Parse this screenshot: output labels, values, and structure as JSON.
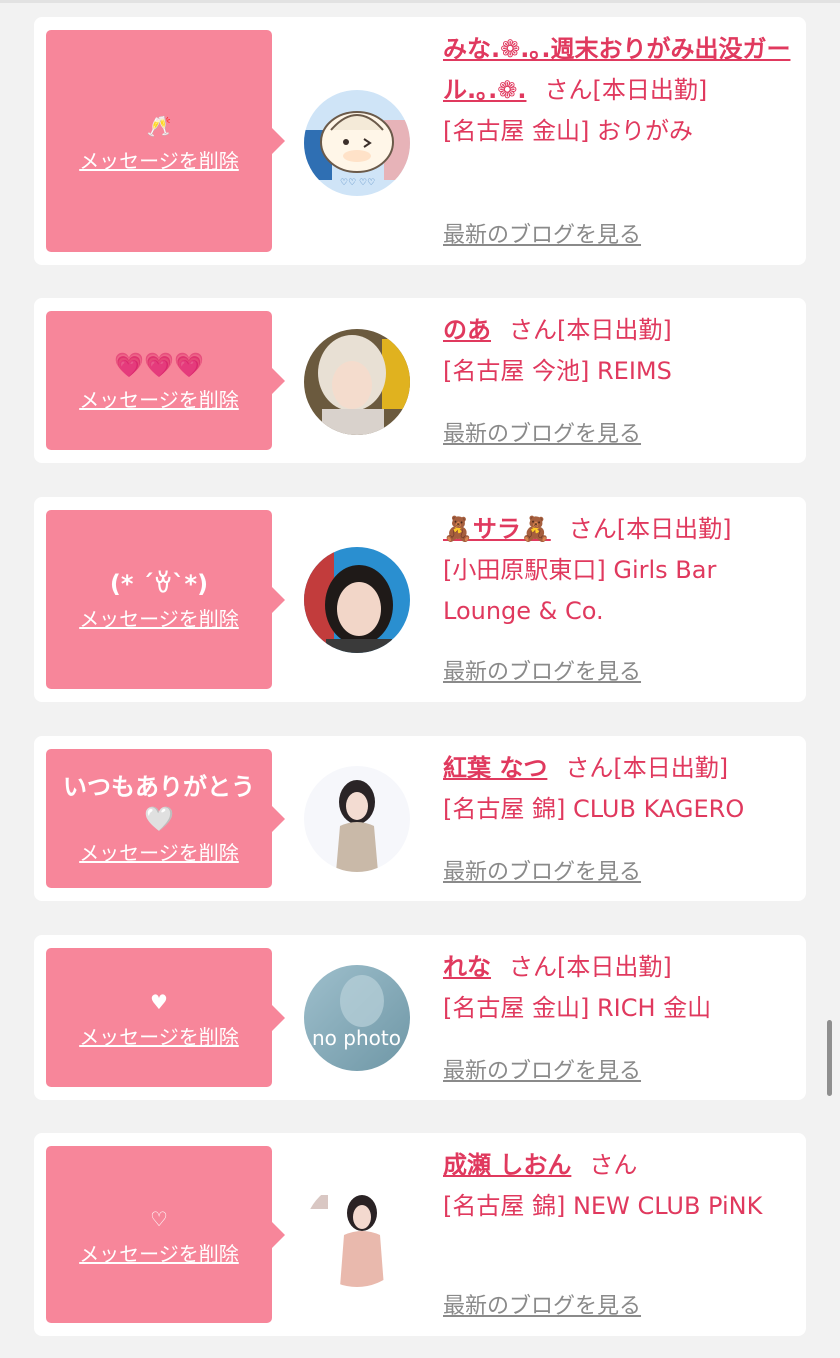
{
  "delete_label": "メッセージを削除",
  "blog_label": "最新のブログを見る",
  "suffix_san": "さん",
  "colors": {
    "bubble": "#f7869a",
    "accent": "#e0395e",
    "link_gray": "#8a8a8a",
    "background": "#f2f2f2"
  },
  "cards": [
    {
      "message": "🥂",
      "name": "みな.❁.｡.週末おりがみ出没ガール.｡.❁.",
      "status": "[本日出勤]",
      "shop": "[名古屋 金山] おりがみ",
      "avatar": "cartoon-character-avatar"
    },
    {
      "message": "💗💗💗",
      "name": "のあ",
      "status": "[本日出勤]",
      "shop": "[名古屋 今池] REIMS",
      "avatar": "profile-photo"
    },
    {
      "message": "(* ´ꈊ`*)",
      "name": "🧸サラ🧸",
      "status": "[本日出勤]",
      "shop": "[小田原駅東口] Girls Bar Lounge & Co.",
      "avatar": "profile-photo"
    },
    {
      "message": "いつもありがとう🤍",
      "name": "紅葉 なつ",
      "status": "[本日出勤]",
      "shop": "[名古屋 錦] CLUB KAGERO",
      "avatar": "profile-photo"
    },
    {
      "message": "♥",
      "name": "れな",
      "status": "[本日出勤]",
      "shop": "[名古屋 金山] RICH 金山",
      "avatar": "no-photo",
      "avatar_text": "no photo"
    },
    {
      "message": "♡",
      "name": "成瀬 しおん",
      "status": "",
      "shop": "[名古屋 錦] NEW CLUB PiNK",
      "avatar": "profile-photo"
    }
  ]
}
